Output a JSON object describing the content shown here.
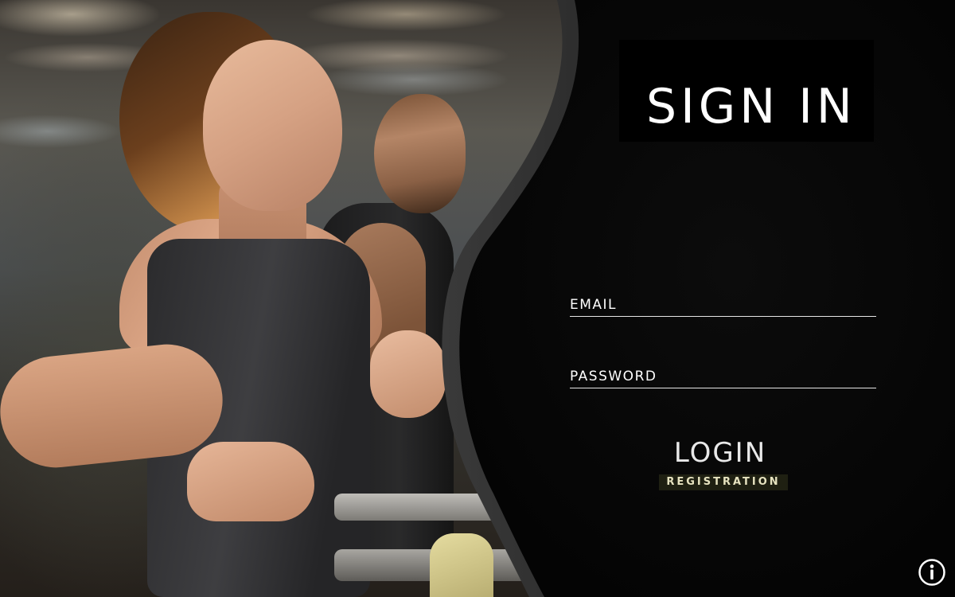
{
  "signin": {
    "title": "SIGN IN"
  },
  "form": {
    "email_label": "EMAIL",
    "email_value": "",
    "password_label": "PASSWORD",
    "password_value": "",
    "login_label": "LOGIN",
    "registration_label": "REGISTRATION"
  },
  "icons": {
    "info": "info-icon"
  },
  "colors": {
    "panel_background": "#050505",
    "text_primary": "#ffffff",
    "registration_background": "#1f2012",
    "registration_text": "#e7e3c0"
  }
}
